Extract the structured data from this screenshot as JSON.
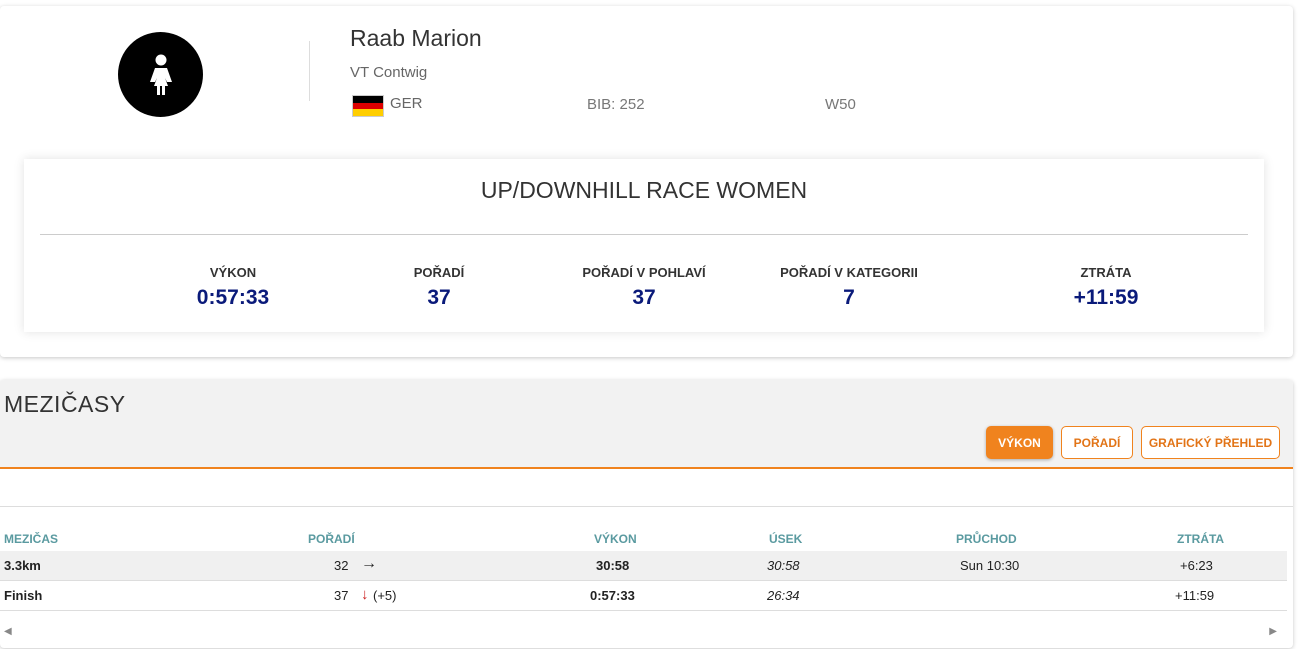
{
  "athlete": {
    "name": "Raab Marion",
    "club": "VT Contwig",
    "country": "GER",
    "bib": "BIB: 252",
    "category": "W50",
    "avatar_icon": "female-person-icon",
    "flag_colors": [
      "#000000",
      "#dd0000",
      "#ffce00"
    ]
  },
  "result": {
    "race_title": "UP/DOWNHILL RACE WOMEN",
    "stats": [
      {
        "label": "VÝKON",
        "value": "0:57:33"
      },
      {
        "label": "POŘADÍ",
        "value": "37"
      },
      {
        "label": "POŘADÍ V POHLAVÍ",
        "value": "37"
      },
      {
        "label": "POŘADÍ V KATEGORII",
        "value": "7"
      },
      {
        "label": "ZTRÁTA",
        "value": "+11:59"
      }
    ]
  },
  "splits": {
    "title": "MEZIČASY",
    "buttons": [
      {
        "label": "VÝKON",
        "active": true
      },
      {
        "label": "POŘADÍ",
        "active": false
      },
      {
        "label": "GRAFICKÝ PŘEHLED",
        "active": false
      }
    ],
    "columns": [
      "MEZIČAS",
      "POŘADÍ",
      "VÝKON",
      "ÚSEK",
      "PRŮCHOD",
      "ZTRÁTA"
    ],
    "rows": [
      {
        "split": "3.3km",
        "rank": "32",
        "trend": "→",
        "trend_icon": "arrow-right-icon",
        "change": "",
        "time": "30:58",
        "segment": "30:58",
        "pass": "Sun 10:30",
        "gap": "+6:23"
      },
      {
        "split": "Finish",
        "rank": "37",
        "trend": "↓",
        "trend_icon": "arrow-down-icon",
        "change": "(+5)",
        "time": "0:57:33",
        "segment": "26:34",
        "pass": "",
        "gap": "+11:59"
      }
    ]
  },
  "colors": {
    "accent": "#f0831e",
    "value_blue": "#0a1a7a",
    "header_teal": "#5a9aa0",
    "down_arrow": "#cc2222"
  }
}
